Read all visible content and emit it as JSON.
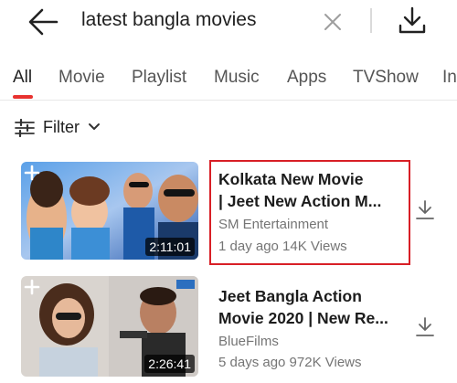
{
  "search": {
    "query": "latest bangla movies"
  },
  "icons": {
    "back": "arrow-left",
    "clear": "close-x",
    "download": "download-arrow",
    "filter": "sliders",
    "chevron": "chevron-down",
    "add": "plus"
  },
  "tabs": [
    {
      "label": "All",
      "active": true
    },
    {
      "label": "Movie"
    },
    {
      "label": "Playlist"
    },
    {
      "label": "Music"
    },
    {
      "label": "Apps"
    },
    {
      "label": "TVShow"
    },
    {
      "label": "In"
    }
  ],
  "filter": {
    "label": "Filter"
  },
  "videos": [
    {
      "title_line1": "Kolkata New Movie",
      "title_line2": "| Jeet New Action M...",
      "channel": "SM Entertainment",
      "meta": "1 day ago 14K Views",
      "duration": "2:11:01",
      "highlighted": true
    },
    {
      "title_line1": "Jeet Bangla Action",
      "title_line2": "Movie 2020 | New Re...",
      "channel": "BlueFilms",
      "meta": "5 days ago 972K Views",
      "duration": "2:26:41",
      "highlighted": false
    }
  ],
  "colors": {
    "accent": "#e8322f",
    "highlight_box": "#d81f26",
    "muted_text": "#757575"
  }
}
